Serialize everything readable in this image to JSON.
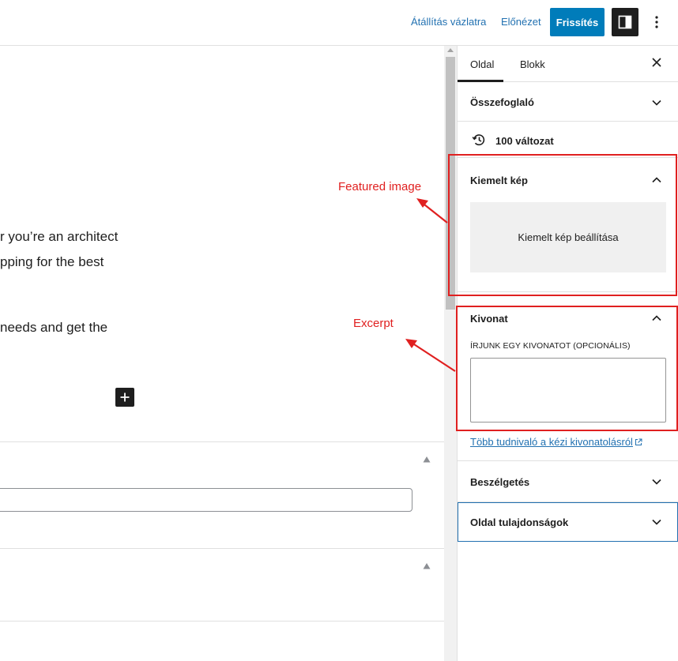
{
  "header": {
    "switch_to_draft": "Átállítás vázlatra",
    "preview": "Előnézet",
    "update": "Frissítés"
  },
  "editor": {
    "lines": [
      "r you’re an architect",
      "pping for the best",
      "needs and get the"
    ]
  },
  "sidebar": {
    "tabs": [
      "Oldal",
      "Blokk"
    ],
    "summary": "Összefoglaló",
    "revisions": "100 változat",
    "featured_image": {
      "title": "Kiemelt kép",
      "set_button": "Kiemelt kép beállítása"
    },
    "excerpt": {
      "title": "Kivonat",
      "label": "Írjunk egy kivonatot (opcionális)",
      "value": "",
      "link": "Több tudnivaló a kézi kivonatolásról"
    },
    "discussion": "Beszélgetés",
    "page_attributes": "Oldal tulajdonságok"
  },
  "annotations": {
    "featured": "Featured image",
    "excerpt": "Excerpt",
    "color": "#e02020"
  },
  "colors": {
    "accent": "#007cba",
    "link": "#2271b1"
  }
}
